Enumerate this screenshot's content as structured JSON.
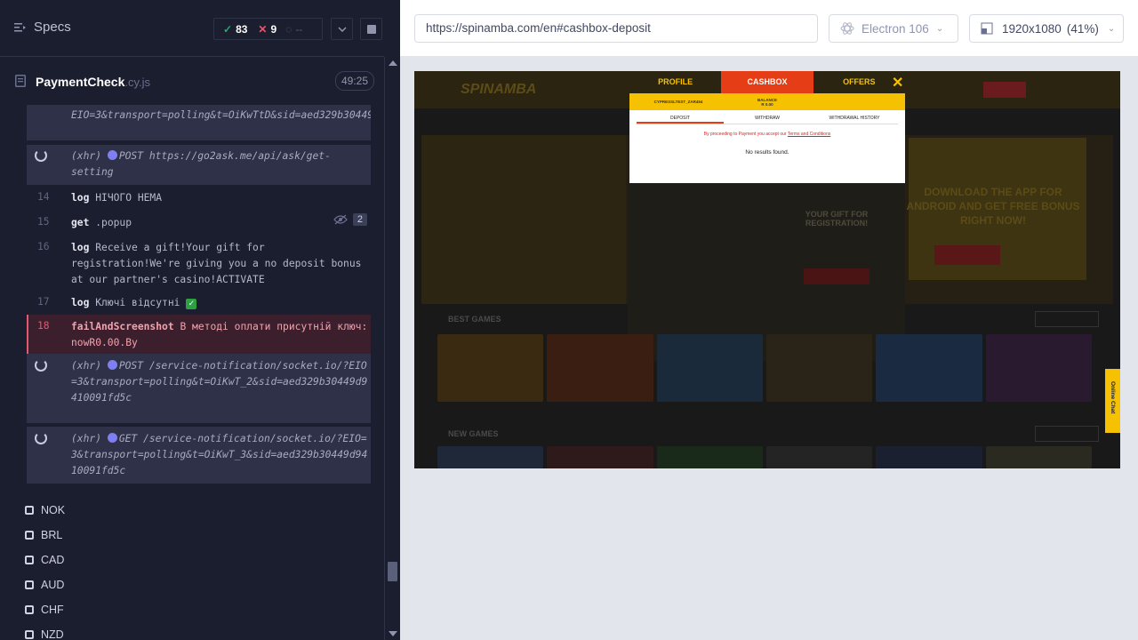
{
  "reporter": {
    "specs_label": "Specs",
    "stats": {
      "passed": "83",
      "failed": "9",
      "pending": "--"
    },
    "file": {
      "name": "PaymentCheck",
      "ext": ".cy.js",
      "duration": "49:25"
    }
  },
  "commands": [
    {
      "type": "xhr-cont",
      "text": "EIO=3&transport=polling&t=OiKwTtD&sid=aed329b30449d9410091fd5c"
    },
    {
      "type": "xhr",
      "prefix": "(xhr)",
      "text": "POST https://go2ask.me/api/ask/get-setting"
    },
    {
      "type": "cmd",
      "num": "14",
      "name": "log",
      "msg": "НІЧОГО НЕМА"
    },
    {
      "type": "cmd",
      "num": "15",
      "name": "get",
      "msg": ".popup",
      "badge": "2"
    },
    {
      "type": "cmd",
      "num": "16",
      "name": "log",
      "msg": "Receive a gift!Your gift for registration!We're giving you a no deposit bonus at our partner's casino!ACTIVATE"
    },
    {
      "type": "cmd",
      "num": "17",
      "name": "log",
      "msg": "Ключі відсутні"
    },
    {
      "type": "failed",
      "num": "18",
      "name": "failAndScreenshot",
      "msg": "В методі оплати присутній ключ: nowR0.00.By"
    },
    {
      "type": "xhr",
      "prefix": "(xhr)",
      "text": "POST /service-notification/socket.io/?EIO=3&transport=polling&t=OiKwT_2&sid=aed329b30449d9410091fd5c"
    },
    {
      "type": "xhr",
      "prefix": "(xhr)",
      "text": "GET /service-notification/socket.io/?EIO=3&transport=polling&t=OiKwT_3&sid=aed329b30449d9410091fd5c"
    }
  ],
  "currencies": [
    "NOK",
    "BRL",
    "CAD",
    "AUD",
    "CHF",
    "NZD"
  ],
  "aut_header": {
    "url": "https://spinamba.com/en#cashbox-deposit",
    "browser": "Electron 106",
    "viewport": "1920x1080",
    "zoom": "(41%)"
  },
  "site": {
    "logo": "SPINAMBA",
    "download_text": "DOWNLOAD THE APP FOR ANDROID AND GET FREE BONUS RIGHT NOW!",
    "gift_text": "YOUR GIFT FOR REGISTRATION!",
    "best_games": "BEST GAMES",
    "new_games": "NEW GAMES",
    "chat": "Online Chat",
    "modal": {
      "tabs": [
        "PROFILE",
        "CASHBOX",
        "OFFERS"
      ],
      "account": "CYPRESSLTEST_ZAR454",
      "balance_label": "BALANCE",
      "balance_value": "R 0.00",
      "subtabs": [
        "DEPOSIT",
        "WITHDRAW",
        "WITHDRAWAL HISTORY"
      ],
      "notice": "By proceeding to Payment you accept our",
      "terms": "Terms and Conditions",
      "no_results": "No results found."
    }
  },
  "colors": {
    "accent_yellow": "#f5c100",
    "accent_red": "#e53e17",
    "fail": "#e45770",
    "pass": "#1fa971"
  }
}
